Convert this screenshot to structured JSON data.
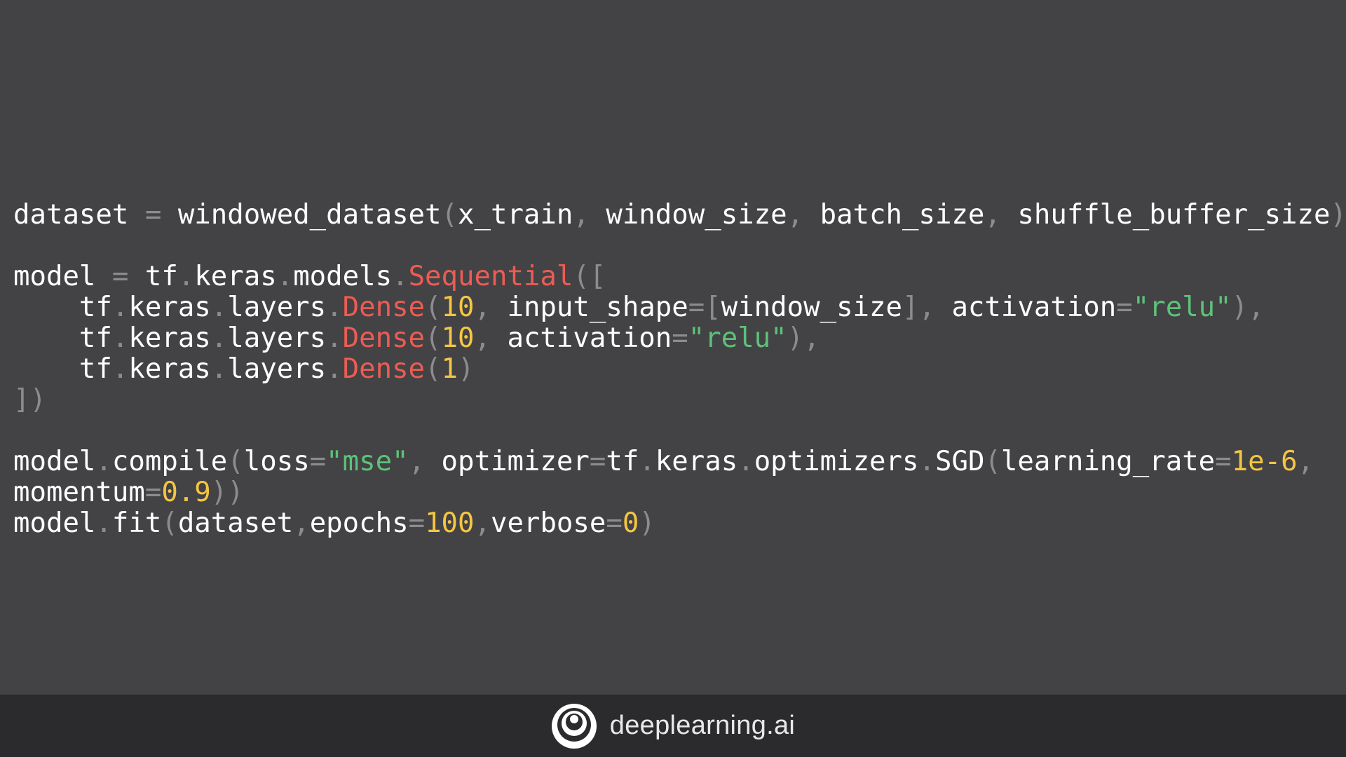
{
  "code": {
    "lines": [
      [
        {
          "t": "dataset",
          "k": "plain"
        },
        {
          "t": " = ",
          "k": "punct"
        },
        {
          "t": "windowed_dataset",
          "k": "plain"
        },
        {
          "t": "(",
          "k": "punct"
        },
        {
          "t": "x_train",
          "k": "plain"
        },
        {
          "t": ", ",
          "k": "punct"
        },
        {
          "t": "window_size",
          "k": "plain"
        },
        {
          "t": ", ",
          "k": "punct"
        },
        {
          "t": "batch_size",
          "k": "plain"
        },
        {
          "t": ", ",
          "k": "punct"
        },
        {
          "t": "shuffle_buffer_size",
          "k": "plain"
        },
        {
          "t": ")",
          "k": "punct"
        }
      ],
      [],
      [
        {
          "t": "model ",
          "k": "plain"
        },
        {
          "t": "= ",
          "k": "punct"
        },
        {
          "t": "tf",
          "k": "plain"
        },
        {
          "t": ".",
          "k": "punct"
        },
        {
          "t": "keras",
          "k": "plain"
        },
        {
          "t": ".",
          "k": "punct"
        },
        {
          "t": "models",
          "k": "plain"
        },
        {
          "t": ".",
          "k": "punct"
        },
        {
          "t": "Sequential",
          "k": "class"
        },
        {
          "t": "([",
          "k": "punct"
        }
      ],
      [
        {
          "t": "    tf",
          "k": "plain"
        },
        {
          "t": ".",
          "k": "punct"
        },
        {
          "t": "keras",
          "k": "plain"
        },
        {
          "t": ".",
          "k": "punct"
        },
        {
          "t": "layers",
          "k": "plain"
        },
        {
          "t": ".",
          "k": "punct"
        },
        {
          "t": "Dense",
          "k": "class"
        },
        {
          "t": "(",
          "k": "punct"
        },
        {
          "t": "10",
          "k": "num"
        },
        {
          "t": ", ",
          "k": "punct"
        },
        {
          "t": "input_shape",
          "k": "plain"
        },
        {
          "t": "=[",
          "k": "punct"
        },
        {
          "t": "window_size",
          "k": "plain"
        },
        {
          "t": "], ",
          "k": "punct"
        },
        {
          "t": "activation",
          "k": "plain"
        },
        {
          "t": "=",
          "k": "punct"
        },
        {
          "t": "\"relu\"",
          "k": "str"
        },
        {
          "t": "),",
          "k": "punct"
        }
      ],
      [
        {
          "t": "    tf",
          "k": "plain"
        },
        {
          "t": ".",
          "k": "punct"
        },
        {
          "t": "keras",
          "k": "plain"
        },
        {
          "t": ".",
          "k": "punct"
        },
        {
          "t": "layers",
          "k": "plain"
        },
        {
          "t": ".",
          "k": "punct"
        },
        {
          "t": "Dense",
          "k": "class"
        },
        {
          "t": "(",
          "k": "punct"
        },
        {
          "t": "10",
          "k": "num"
        },
        {
          "t": ", ",
          "k": "punct"
        },
        {
          "t": "activation",
          "k": "plain"
        },
        {
          "t": "=",
          "k": "punct"
        },
        {
          "t": "\"relu\"",
          "k": "str"
        },
        {
          "t": "),",
          "k": "punct"
        }
      ],
      [
        {
          "t": "    tf",
          "k": "plain"
        },
        {
          "t": ".",
          "k": "punct"
        },
        {
          "t": "keras",
          "k": "plain"
        },
        {
          "t": ".",
          "k": "punct"
        },
        {
          "t": "layers",
          "k": "plain"
        },
        {
          "t": ".",
          "k": "punct"
        },
        {
          "t": "Dense",
          "k": "class"
        },
        {
          "t": "(",
          "k": "punct"
        },
        {
          "t": "1",
          "k": "num"
        },
        {
          "t": ")",
          "k": "punct"
        }
      ],
      [
        {
          "t": "])",
          "k": "punct"
        }
      ],
      [],
      [
        {
          "t": "model",
          "k": "plain"
        },
        {
          "t": ".",
          "k": "punct"
        },
        {
          "t": "compile",
          "k": "plain"
        },
        {
          "t": "(",
          "k": "punct"
        },
        {
          "t": "loss",
          "k": "plain"
        },
        {
          "t": "=",
          "k": "punct"
        },
        {
          "t": "\"mse\"",
          "k": "str"
        },
        {
          "t": ", ",
          "k": "punct"
        },
        {
          "t": "optimizer",
          "k": "plain"
        },
        {
          "t": "=",
          "k": "punct"
        },
        {
          "t": "tf",
          "k": "plain"
        },
        {
          "t": ".",
          "k": "punct"
        },
        {
          "t": "keras",
          "k": "plain"
        },
        {
          "t": ".",
          "k": "punct"
        },
        {
          "t": "optimizers",
          "k": "plain"
        },
        {
          "t": ".",
          "k": "punct"
        },
        {
          "t": "SGD",
          "k": "plain"
        },
        {
          "t": "(",
          "k": "punct"
        },
        {
          "t": "learning_rate",
          "k": "plain"
        },
        {
          "t": "=",
          "k": "punct"
        },
        {
          "t": "1e-6",
          "k": "num"
        },
        {
          "t": ",",
          "k": "punct"
        }
      ],
      [
        {
          "t": "momentum",
          "k": "plain"
        },
        {
          "t": "=",
          "k": "punct"
        },
        {
          "t": "0.9",
          "k": "num"
        },
        {
          "t": "))",
          "k": "punct"
        }
      ],
      [
        {
          "t": "model",
          "k": "plain"
        },
        {
          "t": ".",
          "k": "punct"
        },
        {
          "t": "fit",
          "k": "plain"
        },
        {
          "t": "(",
          "k": "punct"
        },
        {
          "t": "dataset",
          "k": "plain"
        },
        {
          "t": ",",
          "k": "punct"
        },
        {
          "t": "epochs",
          "k": "plain"
        },
        {
          "t": "=",
          "k": "punct"
        },
        {
          "t": "100",
          "k": "num"
        },
        {
          "t": ",",
          "k": "punct"
        },
        {
          "t": "verbose",
          "k": "plain"
        },
        {
          "t": "=",
          "k": "punct"
        },
        {
          "t": "0",
          "k": "num"
        },
        {
          "t": ")",
          "k": "punct"
        }
      ]
    ]
  },
  "footer": {
    "brand": "deeplearning.ai",
    "logo_icon": "deeplearning-ai-logo-icon"
  },
  "colors": {
    "background": "#434345",
    "footer_background": "#2b2b2d",
    "text": "#ffffff",
    "punctuation": "#8c8c8e",
    "class_name": "#ec5c54",
    "number": "#f5c542",
    "string": "#5cc27a"
  }
}
